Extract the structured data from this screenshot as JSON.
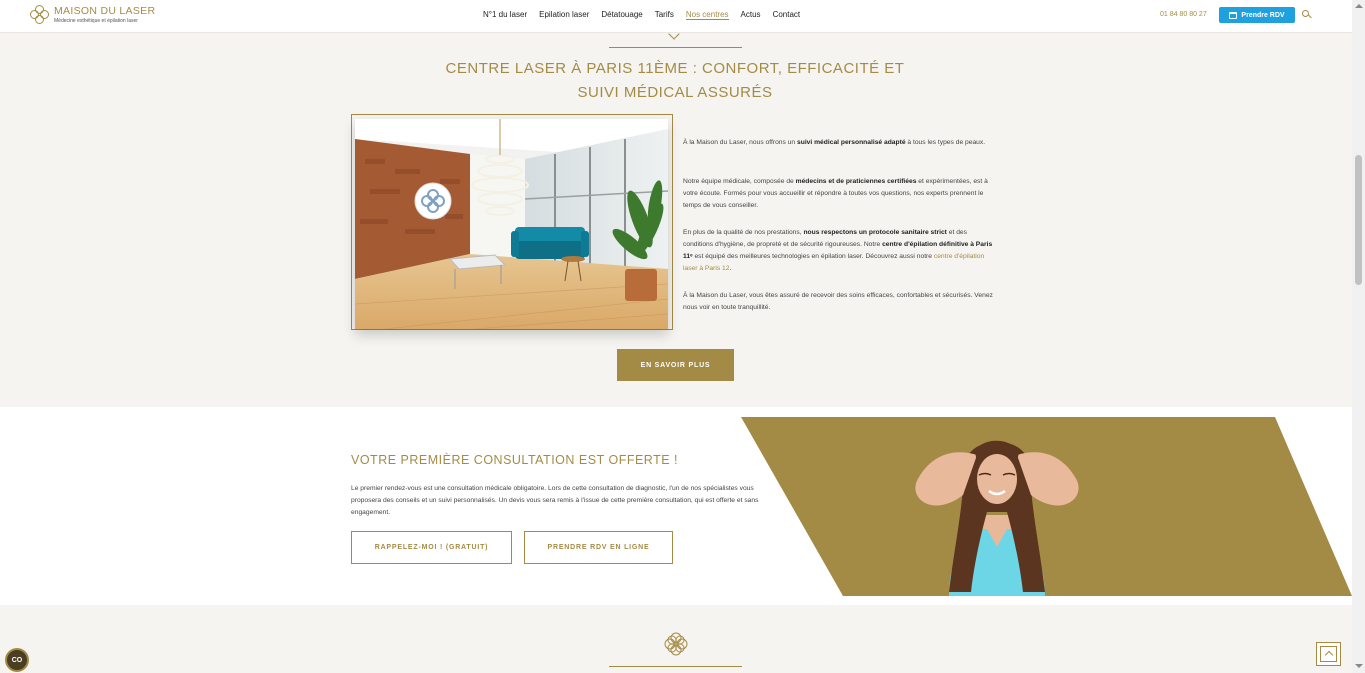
{
  "header": {
    "logo_title": "MAISON DU LASER",
    "logo_subtitle": "Médecine esthétique et épilation laser",
    "nav": [
      "N°1 du laser",
      "Epilation laser",
      "Détatouage",
      "Tarifs",
      "Nos centres",
      "Actus",
      "Contact"
    ],
    "active_nav": "Nos centres",
    "phone": "01 84 80 80 27",
    "rdv_button": "Prendre RDV"
  },
  "section1": {
    "title_line1": "CENTRE LASER À PARIS 11ÈME : CONFORT, EFFICACITÉ ET",
    "title_line2": "SUIVI MÉDICAL ASSURÉS",
    "p1_a": "À la Maison du Laser, nous offrons un ",
    "p1_b": "suivi médical personnalisé adapté",
    "p1_c": " à tous les types de peaux.",
    "p2_a": "Notre équipe médicale, composée de ",
    "p2_b": "médecins et de praticiennes certifiées",
    "p2_c": " et expérimentées, est à votre écoute. Formés pour vous accueillir et répondre à toutes vos questions, nos experts prennent le temps de vous conseiller.",
    "p3_a": "En plus de la qualité de nos prestations, ",
    "p3_b": "nous respectons un protocole sanitaire strict",
    "p3_c": " et des conditions d'hygiène, de propreté et de sécurité rigoureuses. Notre ",
    "p3_d": "centre d'épilation définitive à Paris 11",
    "p3_e": "ᵉ",
    "p3_f": " est équipé des meilleures technologies en épilation laser. Découvrez aussi notre ",
    "p3_link": "centre d'épilation laser à Paris 12",
    "p3_g": ".",
    "p4": "À la Maison du Laser, vous êtes assuré de recevoir des soins efficaces, confortables et sécurisés. Venez nous voir en toute tranquillité.",
    "button": "EN SAVOIR PLUS"
  },
  "section2": {
    "title": "VOTRE PREMIÈRE CONSULTATION EST OFFERTE !",
    "text": "Le premier rendez-vous est une consultation médicale obligatoire. Lors de cette consultation de diagnostic, l'un de nos spécialistes vous proposera des conseils et un suivi personnalisés. Un devis vous sera remis à l'issue de cette première consultation, qui est offerte et sans engagement.",
    "button1": "RAPPELEZ-MOI ! (GRATUIT)",
    "button2": "PRENDRE RDV EN LIGNE"
  },
  "cookie_badge": "CO",
  "colors": {
    "gold": "#a48b45",
    "blue": "#1fa1e0",
    "background": "#f5f4f0"
  }
}
